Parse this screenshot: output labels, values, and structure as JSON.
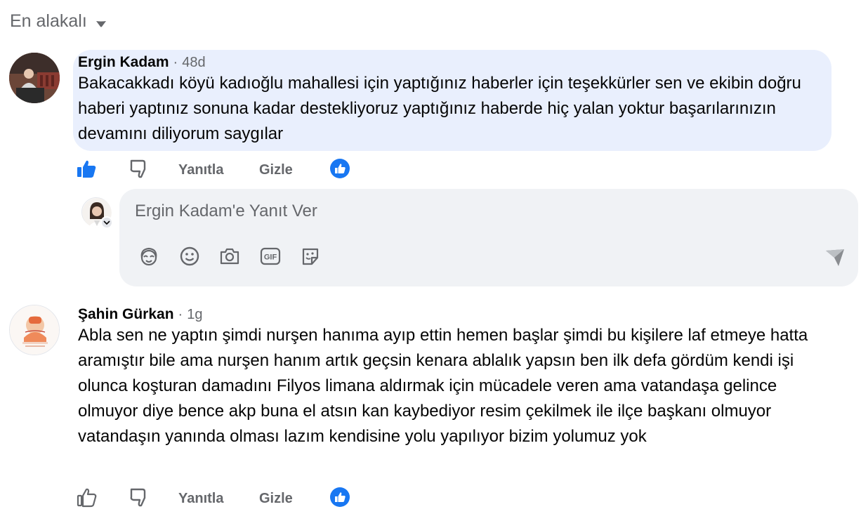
{
  "sort": {
    "label": "En alakalı"
  },
  "comments": [
    {
      "author": "Ergin Kadam",
      "time": "48d",
      "text": "Bakacakkadı köyü kadıoğlu mahallesi için yaptığınız haberler için teşekkürler sen ve ekibin doğru haberi yaptınız sonuna kadar destekliyoruz yaptığınız haberde hiç yalan yoktur başarılarınızın devamını diliyorum saygılar",
      "bubble_color": "#e9effd",
      "liked": true,
      "actions": {
        "reply": "Yanıtla",
        "hide": "Gizle"
      }
    },
    {
      "author": "Şahin Gürkan",
      "time": "1g",
      "text": "Abla sen ne yaptın şimdi nurşen hanıma ayıp ettin hemen başlar şimdi bu kişilere laf etmeye hatta aramıştır bile ama nurşen hanım artık geçsin kenara ablalık yapsın ben ilk defa gördüm kendi işi olunca koşturan damadını Filyos limana aldırmak için mücadele veren ama vatandaşa gelince olmuyor diye bence akp buna el atsın kan kaybediyor resim çekilmek ile ilçe başkanı olmuyor vatandaşın yanında olması lazım kendisine yolu yapılıyor bizim yolumuz yok",
      "bubble_color": "#ffffff",
      "liked": false,
      "actions": {
        "reply": "Yanıtla",
        "hide": "Gizle"
      }
    }
  ],
  "reply_box": {
    "placeholder": "Ergin Kadam'e Yanıt Ver",
    "tools": [
      "avatar-sticker-icon",
      "emoji-icon",
      "camera-icon",
      "gif-icon",
      "sticker-icon"
    ]
  },
  "colors": {
    "accent": "#1877f2",
    "secondary_text": "#65676b",
    "reply_bg": "#f0f2f5"
  }
}
